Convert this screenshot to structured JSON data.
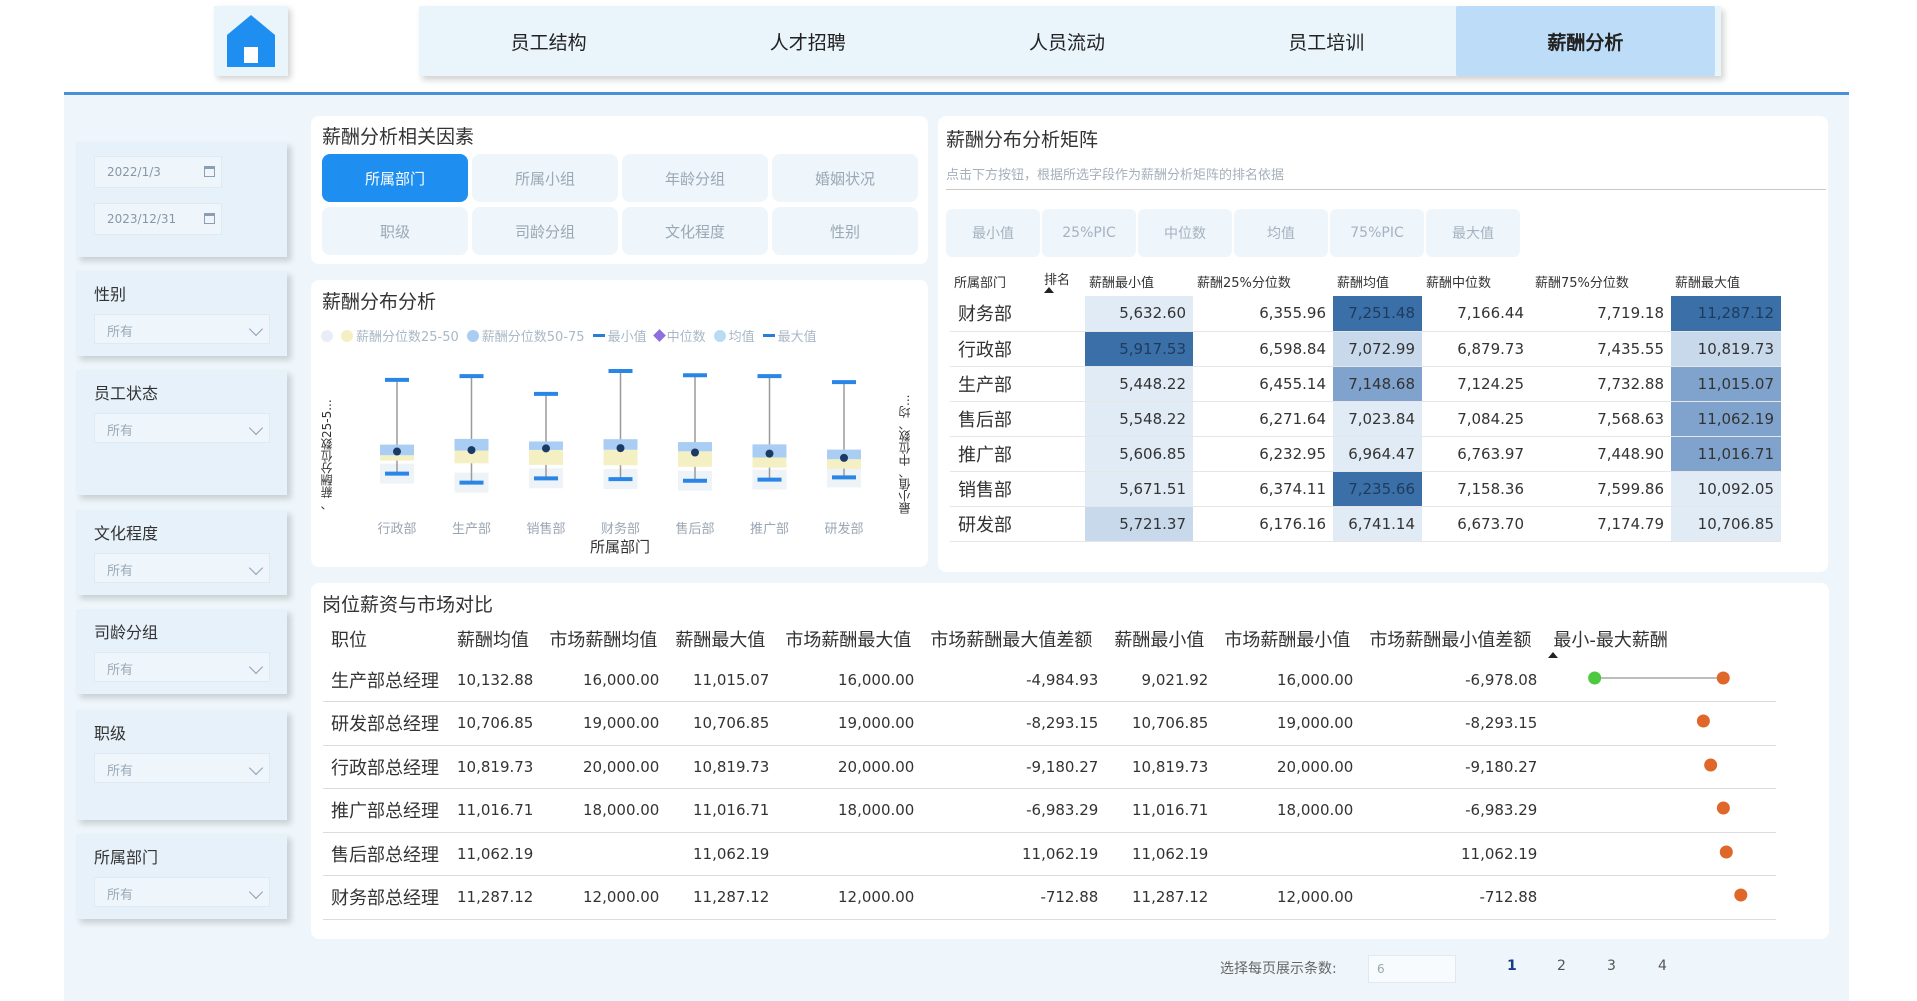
{
  "nav": {
    "home_icon": "home-icon",
    "tabs": [
      {
        "label": "员工结构"
      },
      {
        "label": "人才招聘"
      },
      {
        "label": "人员流动"
      },
      {
        "label": "员工培训"
      },
      {
        "label": "薪酬分析"
      }
    ],
    "active_tab": "薪酬分析"
  },
  "sidebar": {
    "date_start": "2022/1/3",
    "date_end": "2023/12/31",
    "filters": [
      {
        "label": "性别",
        "value": "所有"
      },
      {
        "label": "员工状态",
        "value": "所有"
      },
      {
        "label": "文化程度",
        "value": "所有"
      },
      {
        "label": "司龄分组",
        "value": "所有"
      },
      {
        "label": "职级",
        "value": "所有"
      },
      {
        "label": "所属部门",
        "value": "所有"
      }
    ]
  },
  "factors": {
    "title": "薪酬分析相关因素",
    "buttons": [
      "所属部门",
      "所属小组",
      "年龄分组",
      "婚姻状况",
      "职级",
      "司龄分组",
      "文化程度",
      "性别"
    ],
    "active": "所属部门"
  },
  "dist_chart": {
    "title": "薪酬分布分析",
    "legend": [
      "薪酬分位数25-50",
      "薪酬分位数50-75",
      "最小值",
      "中位数",
      "均值",
      "最大值"
    ],
    "left_axis_label": "、薪酬分位数25-5...",
    "right_axis_label": "最小值、中位数、均...",
    "xlabel": "所属部门"
  },
  "chart_data": {
    "type": "box",
    "categories": [
      "行政部",
      "生产部",
      "销售部",
      "财务部",
      "售后部",
      "推广部",
      "研发部"
    ],
    "series": [
      {
        "name": "最小值",
        "values": [
          5917.53,
          5448.22,
          5671.51,
          5632.6,
          5548.22,
          5606.85,
          5721.37
        ]
      },
      {
        "name": "薪酬分位数25-50",
        "values": [
          6598.84,
          6455.14,
          6374.11,
          6355.96,
          6271.64,
          6232.95,
          6176.16
        ]
      },
      {
        "name": "中位数",
        "values": [
          6879.73,
          7124.25,
          7158.36,
          7166.44,
          7084.25,
          6763.97,
          6673.7
        ]
      },
      {
        "name": "均值",
        "values": [
          7072.99,
          7148.68,
          7235.66,
          7251.48,
          7023.84,
          6964.47,
          6741.14
        ]
      },
      {
        "name": "薪酬分位数50-75",
        "values": [
          7435.55,
          7732.88,
          7599.86,
          7719.18,
          7568.63,
          7448.9,
          7174.79
        ]
      },
      {
        "name": "最大值",
        "values": [
          10819.73,
          11015.07,
          10092.05,
          11287.12,
          11062.19,
          11016.71,
          10706.85
        ]
      }
    ],
    "xlabel": "所属部门"
  },
  "matrix": {
    "title": "薪酬分布分析矩阵",
    "subtitle": "点击下方按钮，根据所选字段作为薪酬分析矩阵的排名依据",
    "stat_buttons": [
      "最小值",
      "25%PIC",
      "中位数",
      "均值",
      "75%PIC",
      "最大值"
    ],
    "columns": [
      "所属部门",
      "排名",
      "薪酬最小值",
      "薪酬25%分位数",
      "薪酬均值",
      "薪酬中位数",
      "薪酬75%分位数",
      "薪酬最大值"
    ],
    "rows": [
      {
        "dept": "财务部",
        "min": "5,632.60",
        "p25": "6,355.96",
        "mean": "7,251.48",
        "median": "7,166.44",
        "p75": "7,719.18",
        "max": "11,287.12"
      },
      {
        "dept": "行政部",
        "min": "5,917.53",
        "p25": "6,598.84",
        "mean": "7,072.99",
        "median": "6,879.73",
        "p75": "7,435.55",
        "max": "10,819.73"
      },
      {
        "dept": "生产部",
        "min": "5,448.22",
        "p25": "6,455.14",
        "mean": "7,148.68",
        "median": "7,124.25",
        "p75": "7,732.88",
        "max": "11,015.07"
      },
      {
        "dept": "售后部",
        "min": "5,548.22",
        "p25": "6,271.64",
        "mean": "7,023.84",
        "median": "7,084.25",
        "p75": "7,568.63",
        "max": "11,062.19"
      },
      {
        "dept": "推广部",
        "min": "5,606.85",
        "p25": "6,232.95",
        "mean": "6,964.47",
        "median": "6,763.97",
        "p75": "7,448.90",
        "max": "11,016.71"
      },
      {
        "dept": "销售部",
        "min": "5,671.51",
        "p25": "6,374.11",
        "mean": "7,235.66",
        "median": "7,158.36",
        "p75": "7,599.86",
        "max": "10,092.05"
      },
      {
        "dept": "研发部",
        "min": "5,721.37",
        "p25": "6,176.16",
        "mean": "6,741.14",
        "median": "6,673.70",
        "p75": "7,174.79",
        "max": "10,706.85"
      }
    ],
    "colors": {
      "dark": "#3a6fa8",
      "mid": "#7fa3cc",
      "light": "#c9d9ec",
      "pale": "#e1ebf5"
    }
  },
  "compare": {
    "title": "岗位薪资与市场对比",
    "columns": [
      "职位",
      "薪酬均值",
      "市场薪酬均值",
      "薪酬最大值",
      "市场薪酬最大值",
      "市场薪酬最大值差额",
      "薪酬最小值",
      "市场薪酬最小值",
      "市场薪酬最小值差额",
      "最小-最大薪酬"
    ],
    "rows": [
      {
        "pos": "生产部总经理",
        "mean": "10,132.88",
        "mkt_mean": "16,000.00",
        "max": "11,015.07",
        "mkt_max": "16,000.00",
        "max_diff": "-4,984.93",
        "min": "9,021.92",
        "mkt_min": "16,000.00",
        "min_diff": "-6,978.08",
        "range": [
          9021.92,
          11015.07
        ]
      },
      {
        "pos": "研发部总经理",
        "mean": "10,706.85",
        "mkt_mean": "19,000.00",
        "max": "10,706.85",
        "mkt_max": "19,000.00",
        "max_diff": "-8,293.15",
        "min": "10,706.85",
        "mkt_min": "19,000.00",
        "min_diff": "-8,293.15",
        "range": [
          10706.85,
          10706.85
        ]
      },
      {
        "pos": "行政部总经理",
        "mean": "10,819.73",
        "mkt_mean": "20,000.00",
        "max": "10,819.73",
        "mkt_max": "20,000.00",
        "max_diff": "-9,180.27",
        "min": "10,819.73",
        "mkt_min": "20,000.00",
        "min_diff": "-9,180.27",
        "range": [
          10819.73,
          10819.73
        ]
      },
      {
        "pos": "推广部总经理",
        "mean": "11,016.71",
        "mkt_mean": "18,000.00",
        "max": "11,016.71",
        "mkt_max": "18,000.00",
        "max_diff": "-6,983.29",
        "min": "11,016.71",
        "mkt_min": "18,000.00",
        "min_diff": "-6,983.29",
        "range": [
          11016.71,
          11016.71
        ]
      },
      {
        "pos": "售后部总经理",
        "mean": "11,062.19",
        "mkt_mean": "",
        "max": "11,062.19",
        "mkt_max": "",
        "max_diff": "11,062.19",
        "min": "11,062.19",
        "mkt_min": "",
        "min_diff": "11,062.19",
        "range": [
          11062.19,
          11062.19
        ]
      },
      {
        "pos": "财务部总经理",
        "mean": "11,287.12",
        "mkt_mean": "12,000.00",
        "max": "11,287.12",
        "mkt_max": "12,000.00",
        "max_diff": "-712.88",
        "min": "11,287.12",
        "mkt_min": "12,000.00",
        "min_diff": "-712.88",
        "range": [
          11287.12,
          11287.12
        ]
      }
    ],
    "colors": {
      "min_dot": "#4cc93f",
      "max_dot": "#e0672a"
    }
  },
  "pager": {
    "label": "选择每页展示条数:",
    "page_size": "6",
    "pages": [
      "1",
      "2",
      "3",
      "4"
    ],
    "current": "1"
  }
}
